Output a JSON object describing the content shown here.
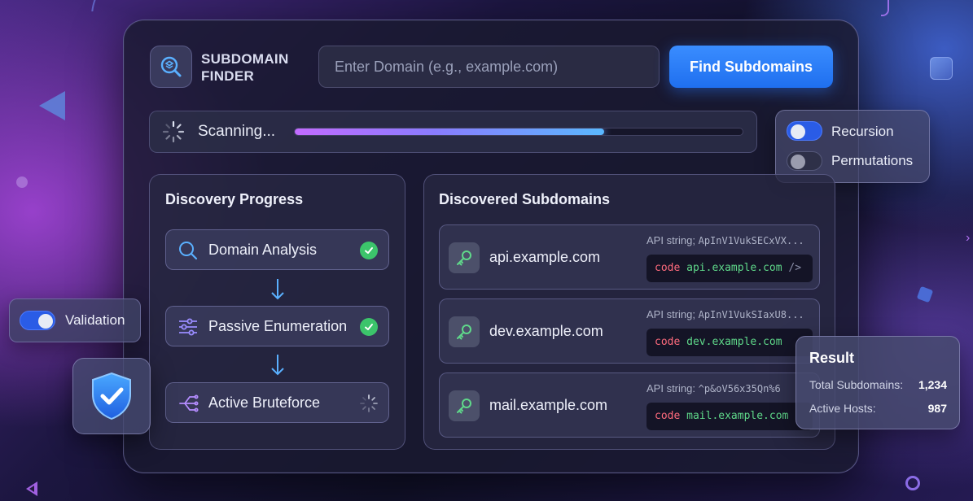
{
  "app": {
    "title_line1": "SUBDOMAIN",
    "title_line2": "FINDER"
  },
  "search": {
    "placeholder": "Enter Domain (e.g., example.com)",
    "value": "",
    "button_label": "Find Subdomains"
  },
  "scan": {
    "status_label": "Scanning...",
    "progress": 0.69
  },
  "options": [
    {
      "label": "Recursion",
      "enabled": true
    },
    {
      "label": "Permutations",
      "enabled": false
    }
  ],
  "discovery": {
    "title": "Discovery Progress",
    "steps": [
      {
        "label": "Domain Analysis",
        "status": "done",
        "icon": "search-icon"
      },
      {
        "label": "Passive Enumeration",
        "status": "done",
        "icon": "sliders-icon"
      },
      {
        "label": "Active Bruteforce",
        "status": "running",
        "icon": "branch-icon"
      }
    ]
  },
  "subdomains": {
    "title": "Discovered Subdomains",
    "items": [
      {
        "name": "api.example.com",
        "api_label": "API string;",
        "api_value": "ApInV1VukSECxVX...",
        "code_keyword": "code",
        "code_value": "api.example.com",
        "code_tail": "/>"
      },
      {
        "name": "dev.example.com",
        "api_label": "API string;",
        "api_value": "ApInV1VukSIaxU8...",
        "code_keyword": "code",
        "code_value": "dev.example.com",
        "code_tail": ""
      },
      {
        "name": "mail.example.com",
        "api_label": "API string:",
        "api_value": "^p&oV56x35Qn%6",
        "code_keyword": "code",
        "code_value": "mail.example.com",
        "code_tail": ""
      }
    ]
  },
  "validation": {
    "label": "Validation",
    "enabled": true
  },
  "result": {
    "title": "Result",
    "total_label": "Total Subdomains:",
    "total_value": "1,234",
    "active_label": "Active Hosts:",
    "active_value": "987"
  },
  "colors": {
    "accent": "#2a7bff",
    "success": "#3cc46b",
    "code_keyword": "#ff6b7d",
    "code_value": "#5fd98a"
  }
}
